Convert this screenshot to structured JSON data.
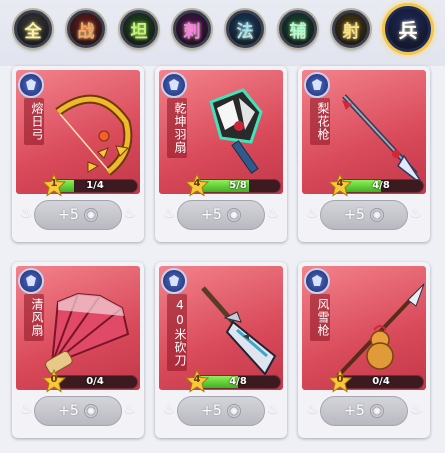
{
  "tabs": [
    {
      "label": "全",
      "active": false,
      "bg": "#3a3a3a",
      "fg": "#fff3a0"
    },
    {
      "label": "战",
      "active": false,
      "bg": "#6b1c1c",
      "fg": "#ffa35a"
    },
    {
      "label": "坦",
      "active": false,
      "bg": "#1e4a1e",
      "fg": "#b8ff6a"
    },
    {
      "label": "刺",
      "active": false,
      "bg": "#4a1450",
      "fg": "#ff7af0"
    },
    {
      "label": "法",
      "active": false,
      "bg": "#163e68",
      "fg": "#9ee7ff"
    },
    {
      "label": "辅",
      "active": false,
      "bg": "#164a36",
      "fg": "#a8ffd6"
    },
    {
      "label": "射",
      "active": false,
      "bg": "#4c3a12",
      "fg": "#ffe27a"
    },
    {
      "label": "兵",
      "active": true,
      "bg": "#1e2a66",
      "fg": "#ffffff"
    }
  ],
  "cards": [
    {
      "name": "熔日弓",
      "level": "1",
      "progress_text": "1/4",
      "progress": 0.25,
      "button_label": "+5",
      "item_icon": "golden-bow-icon"
    },
    {
      "name": "乾坤羽扇",
      "level": "4",
      "progress_text": "5/8",
      "progress": 0.625,
      "button_label": "+5",
      "item_icon": "feather-fan-icon"
    },
    {
      "name": "梨花枪",
      "level": "4",
      "progress_text": "4/8",
      "progress": 0.5,
      "button_label": "+5",
      "item_icon": "spear-icon"
    },
    {
      "name": "清风扇",
      "level": "0",
      "progress_text": "0/4",
      "progress": 0.0,
      "button_label": "+5",
      "item_icon": "folding-fan-icon"
    },
    {
      "name": "40米砍刀",
      "level": "4",
      "progress_text": "4/8",
      "progress": 0.5,
      "button_label": "+5",
      "item_icon": "broadsword-icon"
    },
    {
      "name": "风雪枪",
      "level": "0",
      "progress_text": "0/4",
      "progress": 0.0,
      "button_label": "+5",
      "item_icon": "gourd-spear-icon"
    }
  ]
}
